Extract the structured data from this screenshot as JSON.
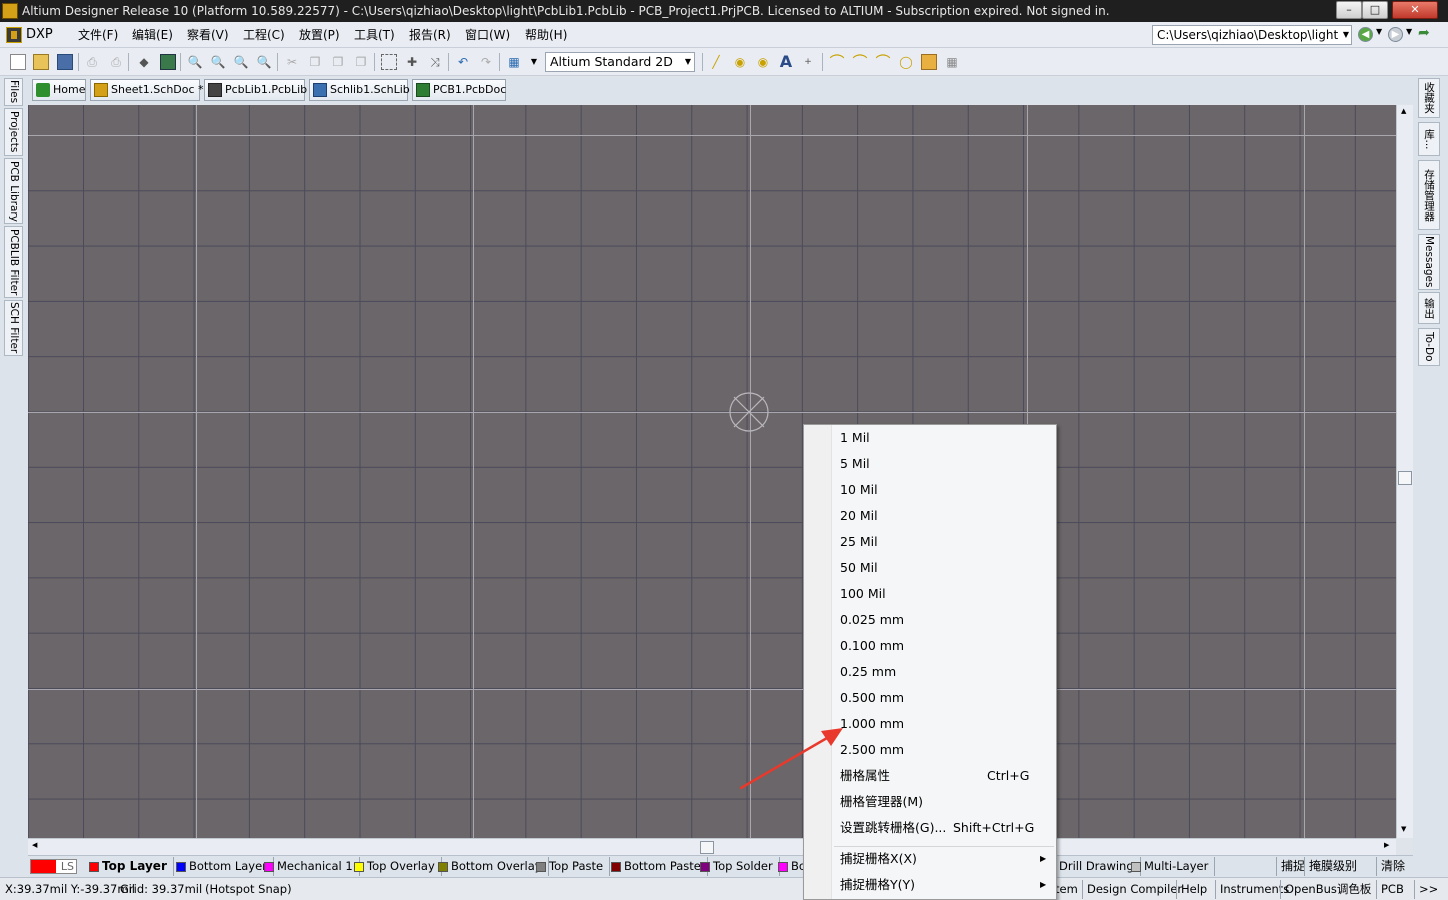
{
  "window": {
    "title": "Altium Designer Release 10 (Platform 10.589.22577) - C:\\Users\\qizhiao\\Desktop\\light\\PcbLib1.PcbLib - PCB_Project1.PrjPCB. Licensed to ALTIUM - Subscription expired. Not signed in.",
    "minimize": "–",
    "maximize": "□",
    "close": "✕"
  },
  "menubar": {
    "dxp": "DXP",
    "items": [
      "文件(F)",
      "编辑(E)",
      "察看(V)",
      "工程(C)",
      "放置(P)",
      "工具(T)",
      "报告(R)",
      "窗口(W)",
      "帮助(H)"
    ],
    "path": "C:\\Users\\qizhiao\\Desktop\\light",
    "nav_icons": [
      "back-icon",
      "forward-icon",
      "home-arrow-icon"
    ]
  },
  "toolbar": {
    "view_mode": "Altium Standard 2D",
    "icons": [
      "new-icon",
      "open-icon",
      "save-icon",
      "print-icon",
      "print-preview-icon",
      "layers-icon",
      "board-icon",
      "zoom-fit-icon",
      "zoom-out-icon",
      "zoom-area-icon",
      "zoom-selected-icon",
      "cut-icon",
      "copy-icon",
      "paste-icon",
      "rubber-stamp-icon",
      "select-rect-icon",
      "move-icon",
      "cross-select-icon",
      "undo-icon",
      "redo-icon",
      "grid-icon",
      "line-icon",
      "pad-icon",
      "via-icon",
      "string-icon",
      "coordinate-icon",
      "arc-center-icon",
      "arc-edge-icon",
      "arc-any-icon",
      "full-circle-icon",
      "fill-icon",
      "array-paste-icon"
    ]
  },
  "doc_tabs": [
    {
      "label": "Home",
      "icon": "home-icon",
      "color": "#2f8f2f"
    },
    {
      "label": "Sheet1.SchDoc *",
      "icon": "schematic-icon",
      "color": "#d4a017"
    },
    {
      "label": "PcbLib1.PcbLib",
      "icon": "pcblib-icon",
      "color": "#444444"
    },
    {
      "label": "Schlib1.SchLib",
      "icon": "schlib-icon",
      "color": "#3a6fb0"
    },
    {
      "label": "PCB1.PcbDoc",
      "icon": "pcbdoc-icon",
      "color": "#2e7d32"
    }
  ],
  "left_panels": [
    "Files",
    "Projects",
    "PCB Library",
    "PCBLIB Filter",
    "SCH Filter"
  ],
  "right_panels": [
    "收藏夹",
    "库...",
    "存储管理器",
    "Messages",
    "输出",
    "To-Do"
  ],
  "layers": {
    "ls": "LS",
    "tabs": [
      {
        "label": "Top Layer",
        "color": "#ff0000",
        "bold": true
      },
      {
        "label": "Bottom Layer",
        "color": "#0000ff"
      },
      {
        "label": "Mechanical 1",
        "color": "#ff00ff"
      },
      {
        "label": "Top Overlay",
        "color": "#ffff00"
      },
      {
        "label": "Bottom Overlay",
        "color": "#808000"
      },
      {
        "label": "Top Paste",
        "color": "#808080"
      },
      {
        "label": "Bottom Paste",
        "color": "#800000"
      },
      {
        "label": "Top Solder",
        "color": "#800080"
      },
      {
        "label": "Bo",
        "color": "#ff00ff"
      },
      {
        "label": "Drill Drawing",
        "color": "#ff002a"
      },
      {
        "label": "Multi-Layer",
        "color": "#c0c0c0"
      }
    ],
    "right_buttons": [
      "捕捉",
      "掩膜级别",
      "清除"
    ]
  },
  "status": {
    "coords": "X:39.37mil Y:-39.37mil",
    "grid": "Grid: 39.37mil",
    "snap": "(Hotspot Snap)",
    "buttons": [
      "tem",
      "Design Compiler",
      "Help",
      "Instruments",
      "OpenBus调色板",
      "PCB",
      ">>"
    ]
  },
  "context_menu": {
    "items": [
      {
        "label": "1 Mil"
      },
      {
        "label": "5 Mil"
      },
      {
        "label": "10 Mil"
      },
      {
        "label": "20 Mil"
      },
      {
        "label": "25 Mil"
      },
      {
        "label": "50 Mil"
      },
      {
        "label": "100 Mil"
      },
      {
        "label": "0.025 mm"
      },
      {
        "label": "0.100 mm"
      },
      {
        "label": "0.25 mm"
      },
      {
        "label": "0.500 mm"
      },
      {
        "label": "1.000 mm"
      },
      {
        "label": "2.500 mm"
      },
      {
        "label": "栅格属性",
        "shortcut": "Ctrl+G"
      },
      {
        "label": "栅格管理器(M)"
      },
      {
        "label": "设置跳转栅格(G)...",
        "shortcut": "Shift+Ctrl+G"
      },
      {
        "label": "捕捉栅格X(X)",
        "submenu": true
      },
      {
        "label": "捕捉栅格Y(Y)",
        "submenu": true
      }
    ]
  },
  "colors": {
    "canvas_bg": "#6b6669",
    "grid_line": "#4b4a5a",
    "annotation_arrow": "#e8392c"
  }
}
